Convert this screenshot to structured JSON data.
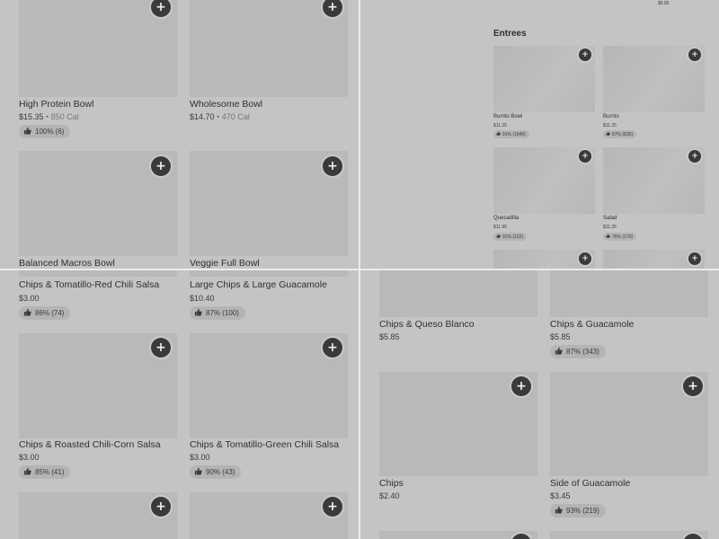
{
  "top_left": {
    "items": [
      {
        "name": "High Protein Bowl",
        "price": "$15.35",
        "calories": "850 Cal",
        "rating": "100% (6)"
      },
      {
        "name": "Wholesome Bowl",
        "price": "$14.70",
        "calories": "470 Cal",
        "rating": ""
      },
      {
        "name": "Balanced Macros Bowl",
        "price": "",
        "calories": "",
        "rating": ""
      },
      {
        "name": "Veggie Full Bowl",
        "price": "",
        "calories": "",
        "rating": ""
      }
    ]
  },
  "top_right": {
    "top_price": "$5.85",
    "section_title": "Entrees",
    "items": [
      {
        "name": "Burrito Bowl",
        "price": "$11.25",
        "rating": "91% (1849)"
      },
      {
        "name": "Burrito",
        "price": "$11.25",
        "rating": "87% (835)"
      },
      {
        "name": "Quesadilla",
        "price": "$11.95",
        "rating": "91% (122)"
      },
      {
        "name": "Salad",
        "price": "$11.25",
        "rating": "76% (170)"
      }
    ]
  },
  "bottom_left": {
    "items": [
      {
        "name": "Chips & Tomatillo-Red Chili Salsa",
        "price": "$3.00",
        "rating": "86% (74)"
      },
      {
        "name": "Large Chips & Large Guacamole",
        "price": "$10.40",
        "rating": "87% (100)"
      },
      {
        "name": "Chips & Roasted Chili-Corn Salsa",
        "price": "$3.00",
        "rating": "85% (41)"
      },
      {
        "name": "Chips & Tomatillo-Green Chili Salsa",
        "price": "$3.00",
        "rating": "90% (43)"
      }
    ]
  },
  "bottom_right": {
    "items": [
      {
        "name": "Chips & Queso Blanco",
        "price": "$5.85",
        "rating": ""
      },
      {
        "name": "Chips & Guacamole",
        "price": "$5.85",
        "rating": "87% (343)"
      },
      {
        "name": "Chips",
        "price": "$2.40",
        "rating": ""
      },
      {
        "name": "Side of Guacamole",
        "price": "$3.45",
        "rating": "93% (219)"
      }
    ]
  },
  "icons": {
    "add": "plus-icon",
    "rating": "thumbs-up-icon"
  },
  "add_symbol": "+",
  "colors": {
    "background": "#c4c4c4",
    "button": "#3a3a3a",
    "divider": "#ececec"
  }
}
